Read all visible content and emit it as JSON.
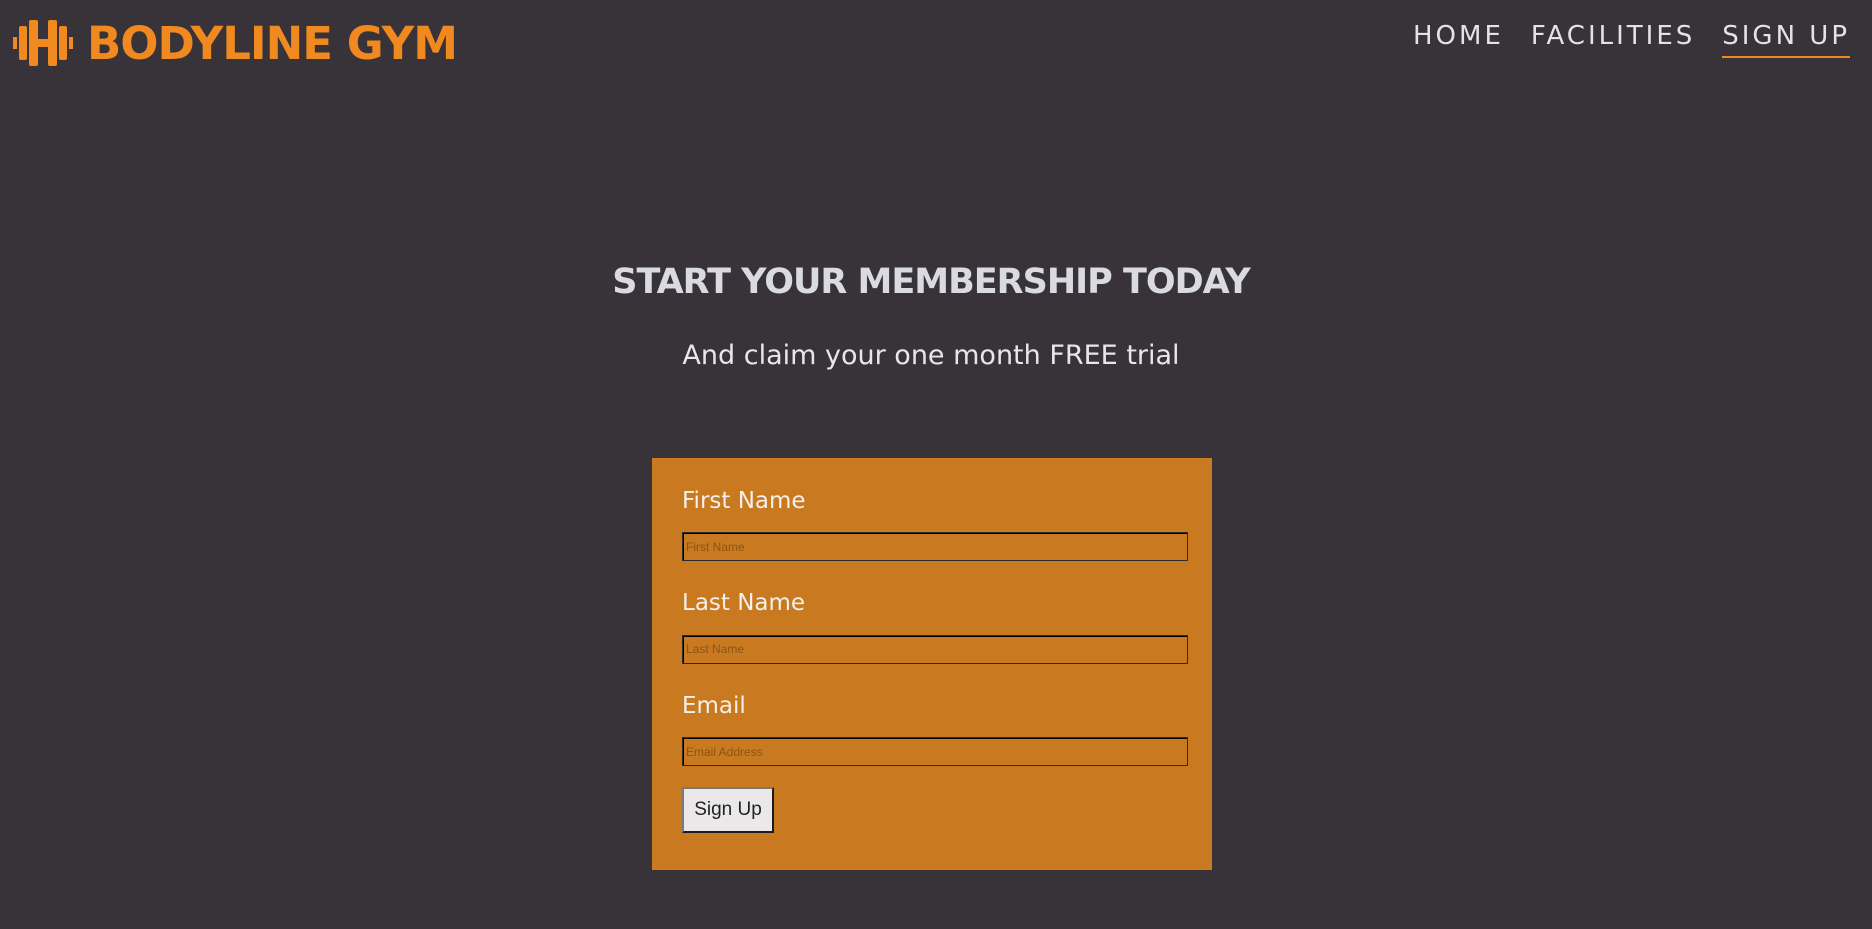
{
  "brand": {
    "name": "BODYLINE GYM",
    "icon": "dumbbell-icon",
    "color": "#f0891f"
  },
  "nav": {
    "items": [
      {
        "label": "HOME"
      },
      {
        "label": "FACILITIES"
      },
      {
        "label": "SIGN UP",
        "active": true
      }
    ]
  },
  "hero": {
    "title": "START YOUR MEMBERSHIP TODAY",
    "subtitle": "And claim your one month FREE trial"
  },
  "form": {
    "first_name": {
      "label": "First Name",
      "placeholder": "First Name",
      "value": ""
    },
    "last_name": {
      "label": "Last Name",
      "placeholder": "Last Name",
      "value": ""
    },
    "email": {
      "label": "Email",
      "placeholder": "Email Address",
      "value": ""
    },
    "submit_label": "Sign Up"
  },
  "colors": {
    "background": "#383339",
    "accent": "#f0891f",
    "card": "#c97920"
  }
}
